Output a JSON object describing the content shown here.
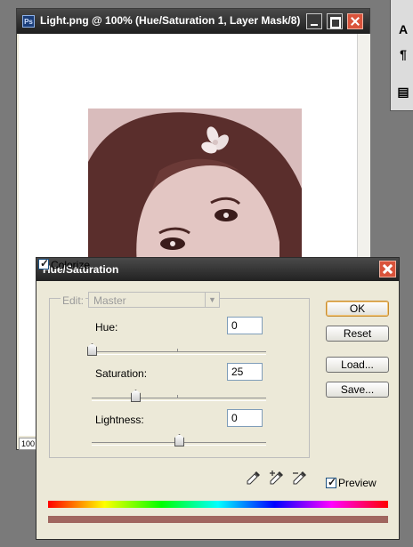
{
  "document_window": {
    "app_icon": "ps-icon",
    "title": "Light.png @ 100% (Hue/Saturation 1, Layer Mask/8)",
    "zoom_field": "100",
    "controls": [
      "minimize-icon",
      "maximize-icon",
      "close-icon"
    ]
  },
  "toolbar": {
    "items": [
      "type-tool-icon",
      "paragraph-icon",
      "panel-icon"
    ],
    "glyphs": [
      "A",
      "¶",
      "▤"
    ]
  },
  "dialog": {
    "title": "Hue/Saturation",
    "edit_label": "Edit:",
    "edit_value": "Master",
    "params": {
      "hue": {
        "label": "Hue:",
        "value": "0",
        "slider_fraction": 0.0
      },
      "saturation": {
        "label": "Saturation:",
        "value": "25",
        "slider_fraction": 0.25
      },
      "lightness": {
        "label": "Lightness:",
        "value": "0",
        "slider_fraction": 0.5
      }
    },
    "buttons": {
      "ok": "OK",
      "reset": "Reset",
      "load": "Load...",
      "save": "Save..."
    },
    "eyedroppers": [
      "eyedropper-icon",
      "eyedropper-plus-icon",
      "eyedropper-minus-icon"
    ],
    "colorize": {
      "label": "Colorize",
      "checked": true
    },
    "preview": {
      "label": "Preview",
      "checked": true
    },
    "colors": {
      "result_bar": "#a0665f",
      "accent_default_button": "#c68b2f"
    }
  }
}
